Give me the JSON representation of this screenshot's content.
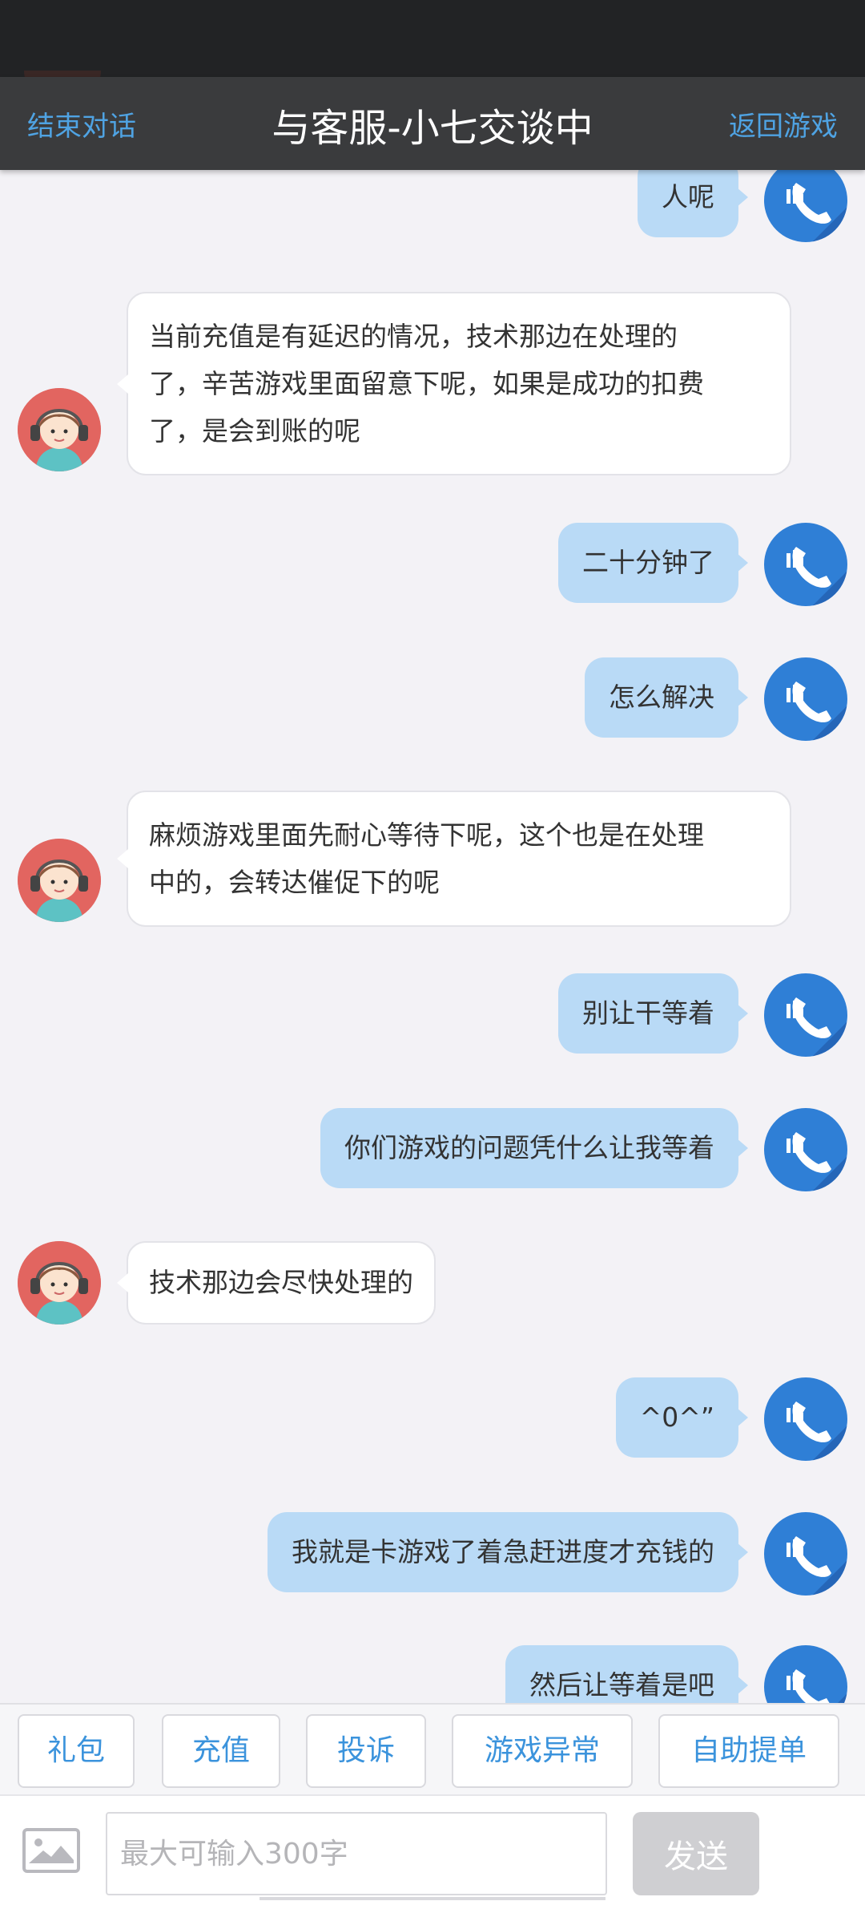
{
  "header": {
    "end_label": "结束对话",
    "title": "与客服-小七交谈中",
    "back_label": "返回游戏"
  },
  "messages": [
    {
      "from": "user",
      "text": "人呢"
    },
    {
      "from": "agent",
      "lines": [
        "当前充值是有延迟的情况，技术那边在处理的",
        "了，辛苦游戏里面留意下呢，如果是成功的扣费",
        "了，是会到账的呢"
      ]
    },
    {
      "from": "user",
      "text": "二十分钟了"
    },
    {
      "from": "user",
      "text": "怎么解决"
    },
    {
      "from": "agent",
      "lines": [
        "麻烦游戏里面先耐心等待下呢，这个也是在处理",
        "中的，会转达催促下的呢"
      ]
    },
    {
      "from": "user",
      "text": "别让干等着"
    },
    {
      "from": "user",
      "text": "你们游戏的问题凭什么让我等着"
    },
    {
      "from": "agent",
      "lines": [
        "技术那边会尽快处理的"
      ]
    },
    {
      "from": "user",
      "text": "^0^”"
    },
    {
      "from": "user",
      "text": "我就是卡游戏了着急赶进度才充钱的"
    },
    {
      "from": "user",
      "text": "然后让等着是吧"
    }
  ],
  "quick_actions": [
    "礼包",
    "充值",
    "投诉",
    "游戏异常",
    "自助提单"
  ],
  "input": {
    "placeholder": "最大可输入300字",
    "send_label": "发送"
  },
  "icons": {
    "user_avatar": "phone-icon",
    "agent_avatar": "agent-headset-avatar",
    "image_button": "image-icon"
  },
  "colors": {
    "accent": "#4fa3e3",
    "user_bubble": "#b9daf6",
    "header": "#3a3b3d"
  }
}
